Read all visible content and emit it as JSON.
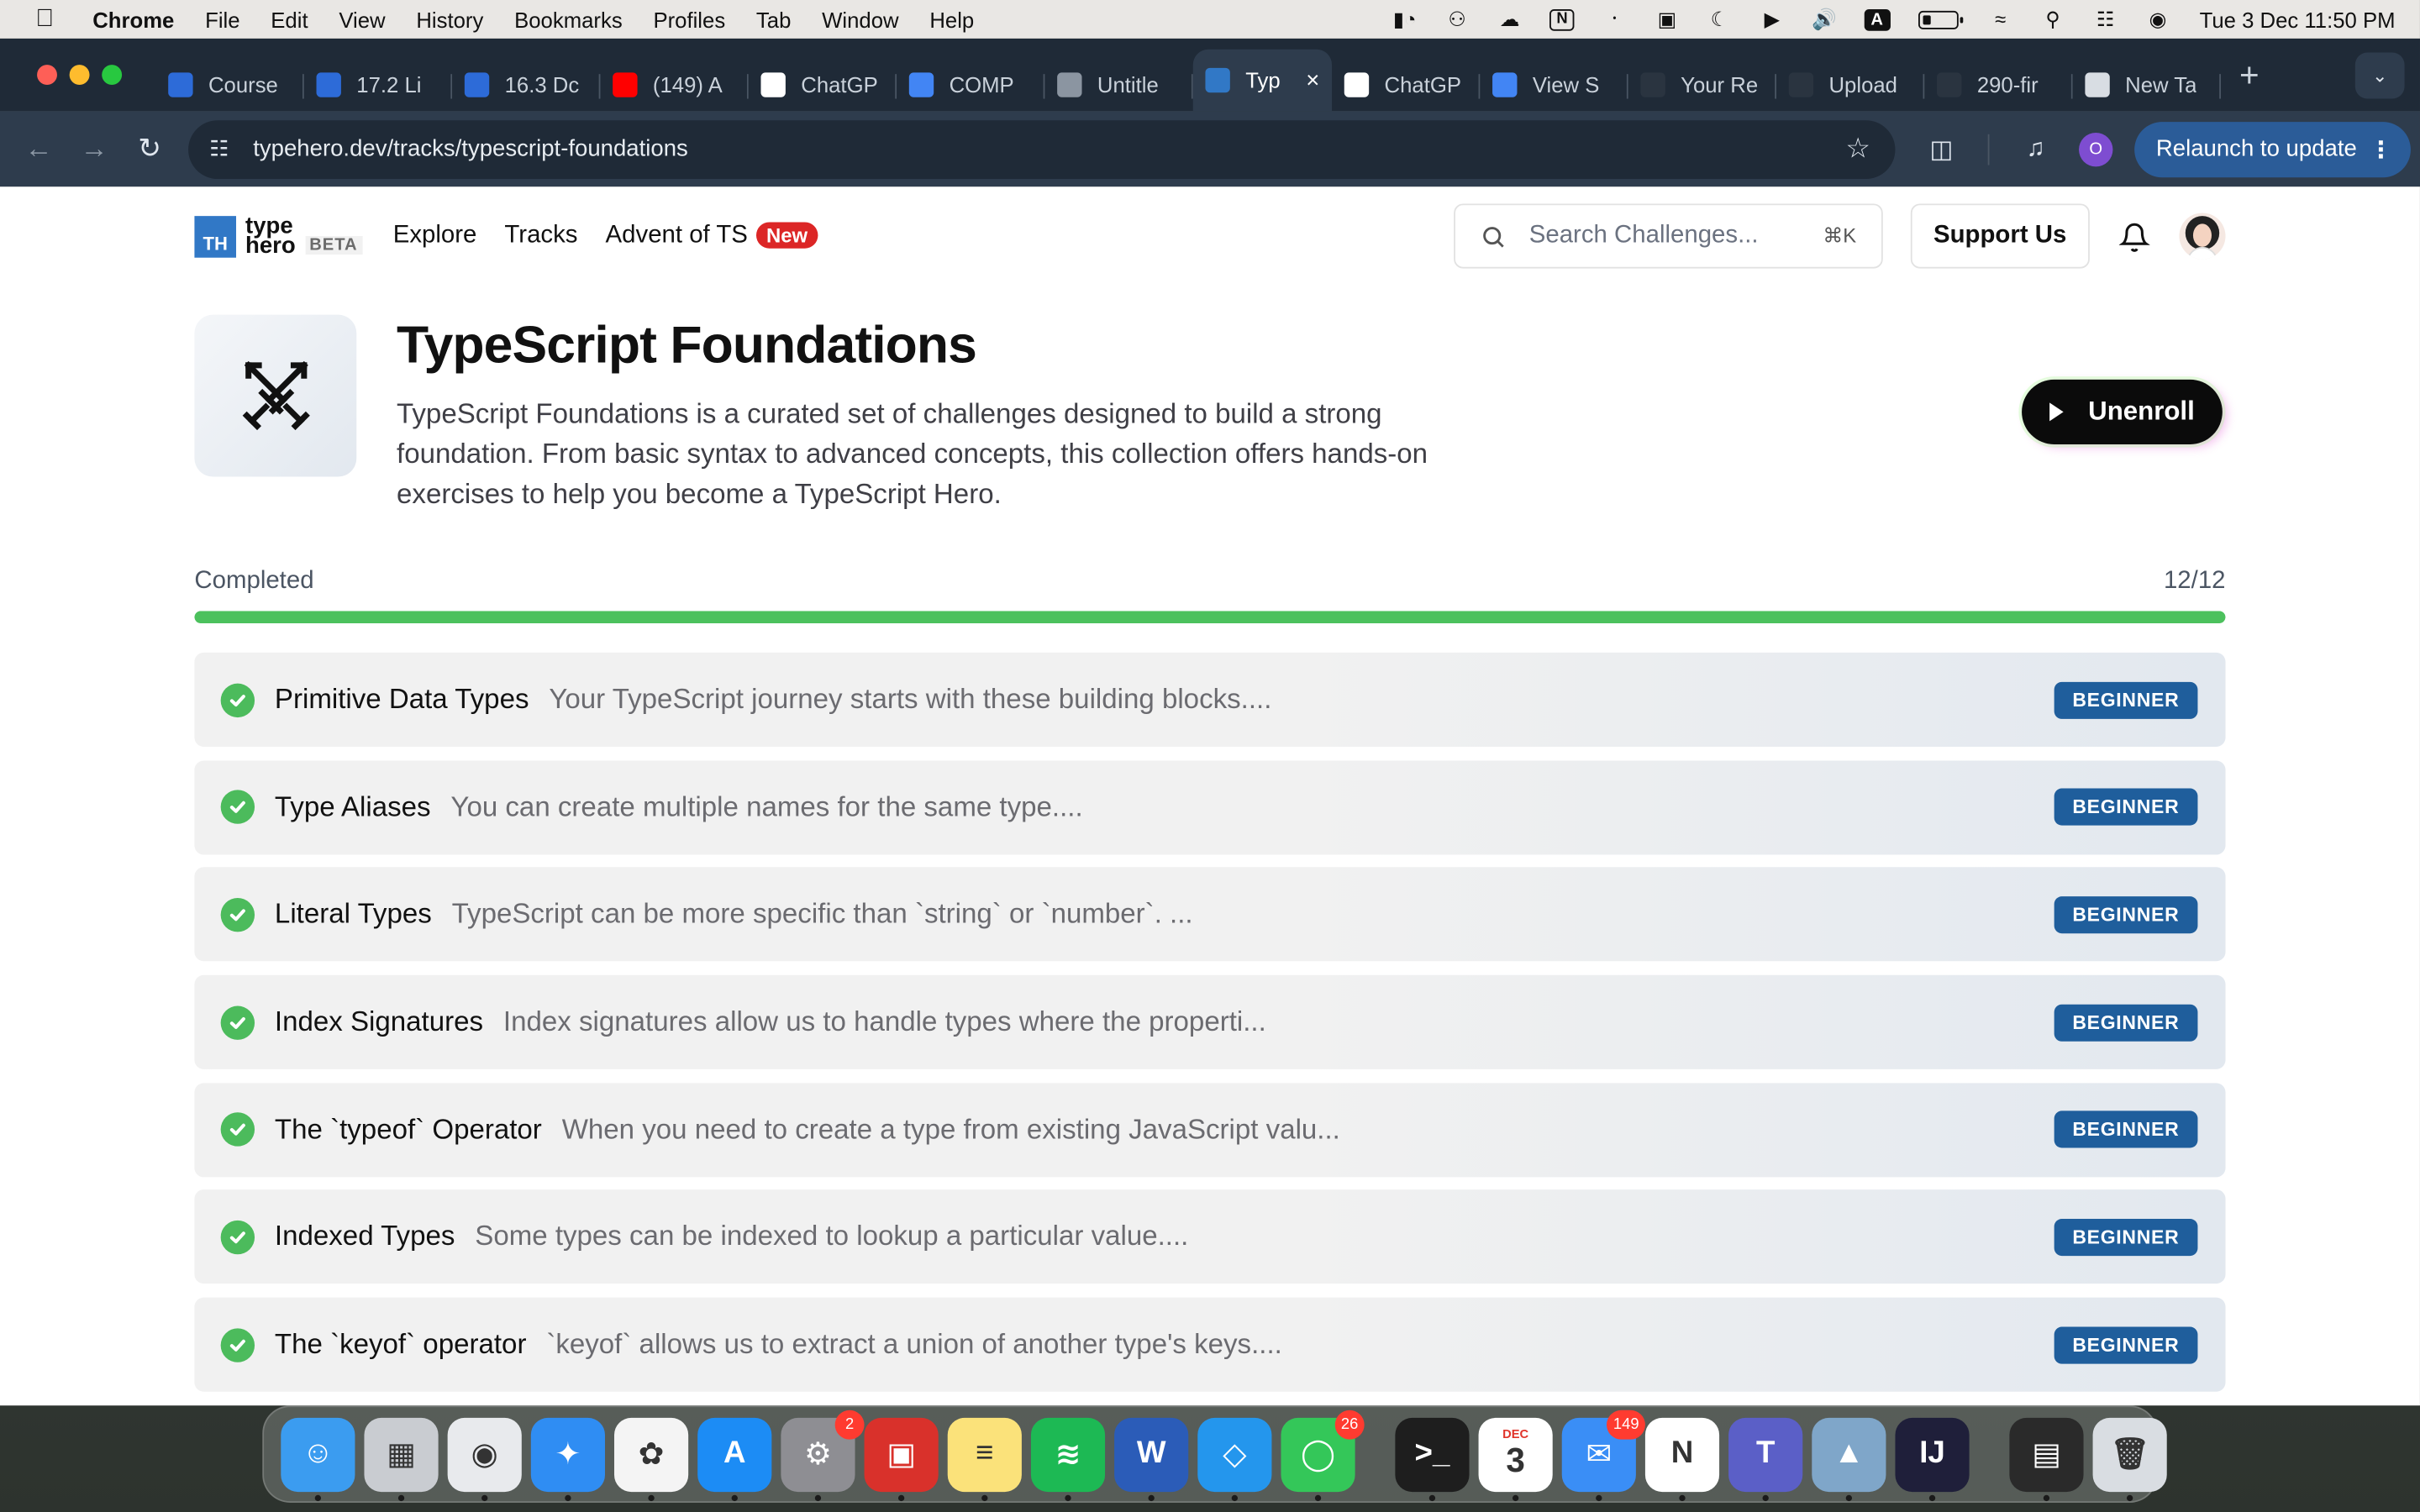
{
  "menubar": {
    "app": "Chrome",
    "items": [
      "File",
      "Edit",
      "View",
      "History",
      "Bookmarks",
      "Profiles",
      "Tab",
      "Window",
      "Help"
    ],
    "clock": "Tue 3 Dec  11:50 PM",
    "status_icons": [
      "data-icon",
      "teams-icon",
      "creative-cloud-icon",
      "notion-icon",
      "bluetooth-icon",
      "display-icon",
      "moon-icon",
      "play-circle-icon",
      "volume-icon",
      "input-source-icon",
      "battery-icon",
      "wifi-icon",
      "search-icon",
      "control-center-icon",
      "siri-icon"
    ],
    "input_source": "A"
  },
  "tabs": [
    {
      "label": "Course",
      "icon": "course-icon",
      "color": "#2d6bd8"
    },
    {
      "label": "17.2 Li",
      "icon": "course-icon",
      "color": "#2d6bd8"
    },
    {
      "label": "16.3 Dc",
      "icon": "course-icon",
      "color": "#2d6bd8"
    },
    {
      "label": "(149) A",
      "icon": "youtube-icon",
      "color": "#ff0000"
    },
    {
      "label": "ChatGP",
      "icon": "chatgpt-icon",
      "color": "#ffffff"
    },
    {
      "label": "COMP",
      "icon": "docs-icon",
      "color": "#4285f4"
    },
    {
      "label": "Untitle",
      "icon": "loading-icon",
      "color": "#8b95a1"
    },
    {
      "label": "Typ",
      "icon": "typehero-icon",
      "color": "#3178c6",
      "active": true
    },
    {
      "label": "ChatGP",
      "icon": "chatgpt-icon",
      "color": "#ffffff"
    },
    {
      "label": "View S",
      "icon": "chart-icon",
      "color": "#4285f4"
    },
    {
      "label": "Your Re",
      "icon": "github-icon",
      "color": "#2a3440"
    },
    {
      "label": "Upload",
      "icon": "github-icon",
      "color": "#2a3440"
    },
    {
      "label": "290-fir",
      "icon": "github-icon",
      "color": "#2a3440"
    },
    {
      "label": "New Ta",
      "icon": "chrome-icon",
      "color": "#d8dde3"
    }
  ],
  "toolbar": {
    "url": "typehero.dev/tracks/typescript-foundations",
    "profile_initial": "O",
    "relaunch_label": "Relaunch to update"
  },
  "site": {
    "logo_line1": "type",
    "logo_line2": "hero",
    "logo_mark": "TH",
    "beta": "BETA",
    "nav": [
      "Explore",
      "Tracks",
      "Advent of TS"
    ],
    "new_badge": "New",
    "search_placeholder": "Search Challenges...",
    "search_shortcut": "⌘K",
    "support_label": "Support Us"
  },
  "track": {
    "title": "TypeScript Foundations",
    "description": "TypeScript Foundations is a curated set of challenges designed to build a strong foundation. From basic syntax to advanced concepts, this collection offers hands-on exercises to help you become a TypeScript Hero.",
    "unenroll_label": "Unenroll",
    "progress_label": "Completed",
    "progress_count": "12/12",
    "progress_fraction": 1.0
  },
  "challenges": [
    {
      "title": "Primitive Data Types",
      "desc": "Your TypeScript journey starts with these building blocks....",
      "difficulty": "BEGINNER"
    },
    {
      "title": "Type Aliases",
      "desc": "You can create multiple names for the same type....",
      "difficulty": "BEGINNER"
    },
    {
      "title": "Literal Types",
      "desc": "TypeScript can be more specific than `string` or `number`. ...",
      "difficulty": "BEGINNER"
    },
    {
      "title": "Index Signatures",
      "desc": "Index signatures allow us to handle types where the properti...",
      "difficulty": "BEGINNER"
    },
    {
      "title": "The `typeof` Operator",
      "desc": "When you need to create a type from existing JavaScript valu...",
      "difficulty": "BEGINNER"
    },
    {
      "title": "Indexed Types",
      "desc": "Some types can be indexed to lookup a particular value....",
      "difficulty": "BEGINNER"
    },
    {
      "title": "The `keyof` operator",
      "desc": "`keyof` allows us to extract a union of another type's keys....",
      "difficulty": "BEGINNER"
    }
  ],
  "dock": [
    {
      "name": "finder",
      "color": "#3b9cf0",
      "glyph": "☺"
    },
    {
      "name": "launchpad",
      "color": "#c9ccd1",
      "glyph": "▦"
    },
    {
      "name": "chrome",
      "color": "#e8eaed",
      "glyph": "◉"
    },
    {
      "name": "safari",
      "color": "#2f8df3",
      "glyph": "✦"
    },
    {
      "name": "photos",
      "color": "#f4f4f4",
      "glyph": "✿"
    },
    {
      "name": "app-store",
      "color": "#1c8cf5",
      "glyph": "A"
    },
    {
      "name": "system-settings",
      "color": "#8e8e93",
      "glyph": "⚙",
      "badge": "2"
    },
    {
      "name": "photo-booth",
      "color": "#d9312b",
      "glyph": "▣"
    },
    {
      "name": "notes",
      "color": "#fbe27a",
      "glyph": "≡"
    },
    {
      "name": "spotify",
      "color": "#1db954",
      "glyph": "≋"
    },
    {
      "name": "word",
      "color": "#2b5cb8",
      "glyph": "W"
    },
    {
      "name": "docker",
      "color": "#2496ed",
      "glyph": "◇"
    },
    {
      "name": "messages",
      "color": "#34c759",
      "glyph": "◯",
      "badge": "26"
    },
    {
      "name": "terminal",
      "color": "#1e1e1e",
      "glyph": ">_",
      "sep_before": true
    },
    {
      "name": "calendar",
      "color": "#ffffff",
      "glyph": "3",
      "sub": "DEC"
    },
    {
      "name": "mail",
      "color": "#3a8ef6",
      "glyph": "✉",
      "badge": "149"
    },
    {
      "name": "notion",
      "color": "#ffffff",
      "glyph": "N"
    },
    {
      "name": "teams",
      "color": "#5b5fc7",
      "glyph": "T"
    },
    {
      "name": "preview",
      "color": "#7fa6c9",
      "glyph": "▲"
    },
    {
      "name": "intellij",
      "color": "#1f1f3a",
      "glyph": "IJ"
    },
    {
      "name": "screenshot",
      "color": "#2a2a2a",
      "glyph": "▤",
      "sep_before": true
    },
    {
      "name": "trash",
      "color": "#d9dde2",
      "glyph": "🗑"
    }
  ],
  "colors": {
    "progress": "#4cc15d",
    "check": "#4cbb5c",
    "difficulty_badge": "#1f5e9c",
    "new_badge": "#dc2626",
    "chrome_frame": "#1f2a37"
  }
}
